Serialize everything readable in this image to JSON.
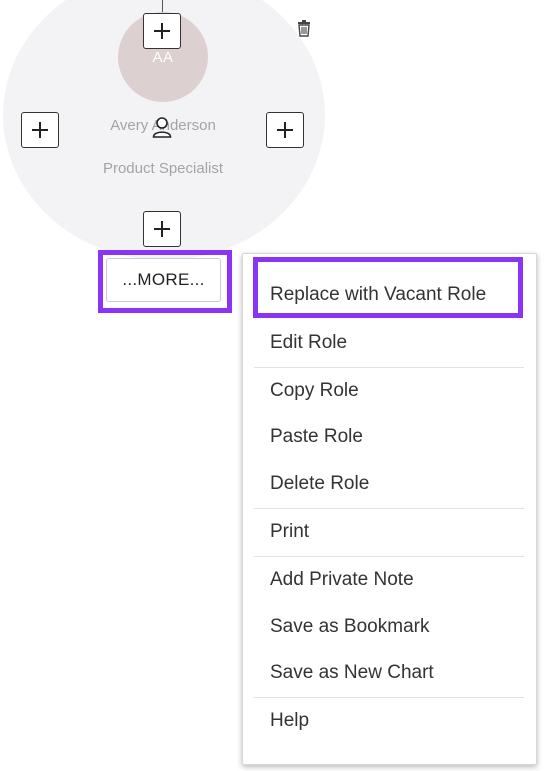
{
  "node": {
    "initials": "AA",
    "name": "Avery Anderson",
    "role_title": "Product Specialist"
  },
  "more_button": {
    "label": "...MORE..."
  },
  "context_menu": {
    "items": [
      "Replace with Vacant Role",
      "Edit Role",
      "Copy Role",
      "Paste Role",
      "Delete Role",
      "Print",
      "Add Private Note",
      "Save as Bookmark",
      "Save as New Chart",
      "Help"
    ]
  },
  "icons": {
    "add": "plus-icon",
    "delete": "trash-icon",
    "person": "person-icon"
  },
  "colors": {
    "highlight": "#8a35f5",
    "avatar_bg": "#dcd0d1",
    "node_bg": "#f3f3f6",
    "muted_text": "#a4a4a4"
  }
}
